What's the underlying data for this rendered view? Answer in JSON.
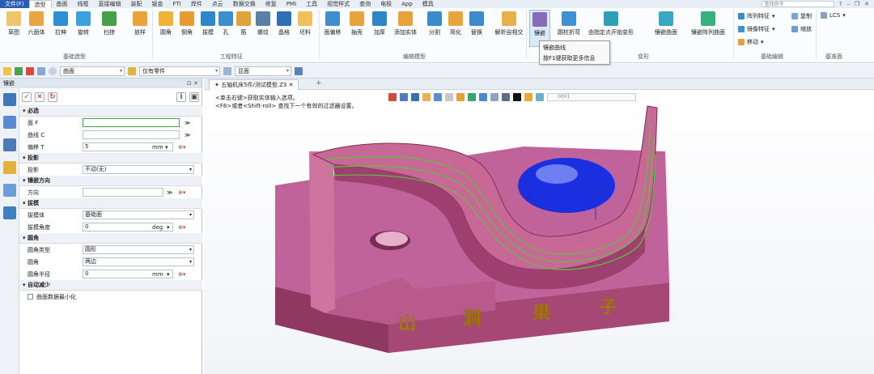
{
  "menubar": {
    "file": "文件(F)",
    "items": [
      "造型",
      "曲面",
      "线框",
      "直接编辑",
      "装配",
      "钣金",
      "FTI",
      "焊件",
      "点云",
      "数据交换",
      "修复",
      "PMI",
      "工具",
      "视觉样式",
      "查询",
      "电极",
      "App",
      "模具"
    ],
    "active_index": 0,
    "search_placeholder": "查找命令"
  },
  "ribbon": {
    "groups": [
      {
        "label": "基础造型",
        "buttons": [
          "草图",
          "六面体",
          "拉伸",
          "旋转",
          "扫掠",
          "放样"
        ]
      },
      {
        "label": "工程特征",
        "buttons": [
          "圆角",
          "倒角",
          "拔模",
          "孔",
          "筋",
          "螺纹",
          "晶格",
          "坯料"
        ]
      },
      {
        "label": "编辑模型",
        "buttons": [
          "面偏移",
          "抽壳",
          "加厚",
          "添加实体",
          "分割",
          "简化",
          "替换",
          "解析自相交"
        ]
      },
      {
        "label": "变形",
        "buttons": [
          "镶嵌",
          "圆柱折弯",
          "由指定点开始变形",
          "镶嵌曲面",
          "镶嵌阵列曲面"
        ]
      },
      {
        "label": "基础编辑",
        "side_commands": [
          "阵列特征",
          "镜像特征",
          "移动",
          "复制",
          "缩放"
        ]
      },
      {
        "label": "基准面",
        "side_commands": [
          "LCS"
        ]
      }
    ]
  },
  "tooltip": {
    "title": "镶嵌曲线",
    "hint": "按F1键获取更多信息"
  },
  "toolbar": {
    "filter_value": "曲面",
    "all_value": "仅有零件",
    "view_value": "显面"
  },
  "panel": {
    "title": "镶嵌",
    "sections": {
      "required": {
        "label": "必选",
        "face": "面 F",
        "curve": "曲线 C",
        "offset": "偏移 T",
        "offset_value": "5",
        "offset_unit": "mm"
      },
      "projection": {
        "label": "投影",
        "row": "投影",
        "value": "不动(无)"
      },
      "direction": {
        "label": "镶嵌方向",
        "row": "方向"
      },
      "draft": {
        "label": "拔模",
        "body_label": "拔模体",
        "body_value": "基础面",
        "angle_label": "拔模角度",
        "angle_value": "0",
        "angle_unit": "deg"
      },
      "fillet": {
        "label": "圆角",
        "type_label": "圆角类型",
        "type_value": "圆形",
        "fillet_label": "圆角",
        "fillet_value": "两边",
        "radius_label": "圆角半径",
        "radius_value": "0",
        "radius_unit": "mm"
      },
      "auto_reduce": {
        "label": "自动减少",
        "option": "曲面数据最小化"
      }
    }
  },
  "viewport": {
    "tab_label": "五轴机床5件/测试模型.Z3",
    "prompt_line1": "<单击右键>获取实体输入选项。",
    "prompt_line2": "<F8>或者<Shift-roll> 查找下一个有效的过滤器设置。",
    "search_placeholder": "0001",
    "engraving_text": [
      "山",
      "涧",
      "果",
      "子"
    ],
    "colors": {
      "model": "#b5517f",
      "model_dark": "#8e3862",
      "model_light": "#cf74a0",
      "sphere": "#1a2fe0",
      "curves": "#5ec23a",
      "text": "#e5b23a"
    }
  }
}
